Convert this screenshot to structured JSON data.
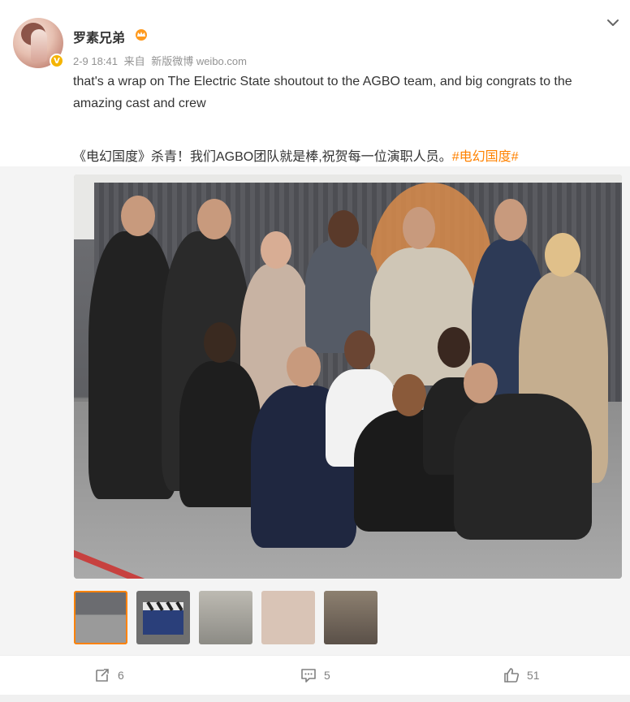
{
  "author": {
    "name": "罗素兄弟",
    "verified_badge": "V",
    "icons": {
      "avatar": "avatar",
      "badge": "crown-icon"
    }
  },
  "meta": {
    "time": "2-9 18:41",
    "source_prefix": "来自",
    "source": "新版微博 weibo.com"
  },
  "post": {
    "text_en": "that's a wrap on The Electric State shoutout to the AGBO team, and big congrats to the amazing cast and crew",
    "text_cn": "《电幻国度》杀青！我们AGBO团队就是棒,祝贺每一位演职人员。",
    "hashtag": "#电幻国度#"
  },
  "media": {
    "photo_icon": "group-photo",
    "thumbnail_count": 5,
    "selected_thumbnail": 1
  },
  "actions": {
    "repost_count": "6",
    "comment_count": "5",
    "like_count": "51"
  },
  "colors": {
    "hashtag": "#ff8200",
    "meta": "#939393",
    "accent": "#ff8200"
  }
}
